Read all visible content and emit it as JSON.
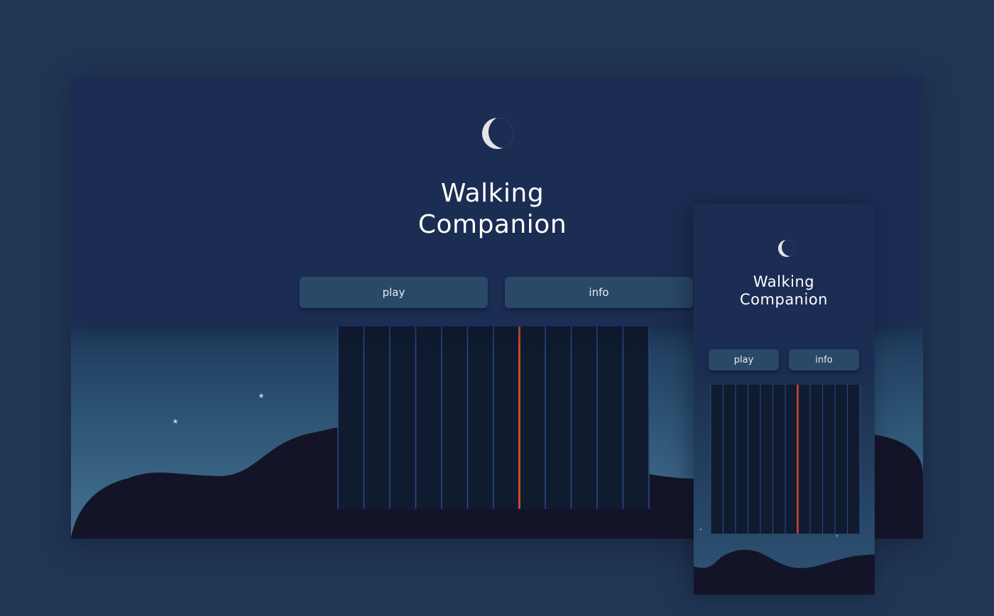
{
  "desktop": {
    "title_line1": "Walking",
    "title_line2": "Companion",
    "play_label": "play",
    "info_label": "info",
    "icon": "crescent-moon-icon",
    "sequencer": {
      "columns": 12,
      "active_column": 7
    }
  },
  "mobile": {
    "title_line1": "Walking",
    "title_line2": "Companion",
    "play_label": "play",
    "info_label": "info",
    "icon": "crescent-moon-icon",
    "sequencer": {
      "columns": 12,
      "active_column": 7
    }
  },
  "colors": {
    "page_background": "#213655",
    "header_background": "#1b2d53",
    "button_background": "#2a4868",
    "button_text": "#e6edf5",
    "moon": "#e3e3ea",
    "hills": "#141428",
    "sequencer_background": "#101b30",
    "sequencer_divider": "#2a4b8a",
    "playhead": "#d0482a",
    "star": "#c9ccd6"
  }
}
